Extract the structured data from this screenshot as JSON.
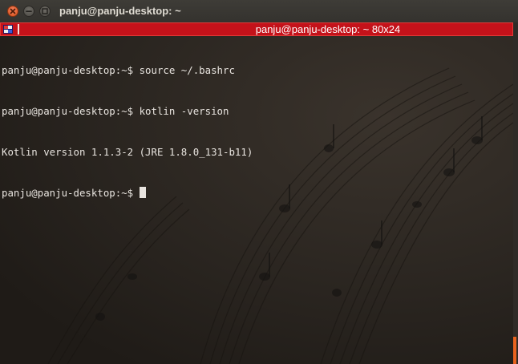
{
  "window": {
    "title": "panju@panju-desktop: ~",
    "buttons": [
      "close",
      "minimize",
      "maximize"
    ]
  },
  "statusbar": {
    "text": "panju@panju-desktop: ~ 80x24",
    "color": "#c4121a"
  },
  "terminal": {
    "lines": [
      "panju@panju-desktop:~$ source ~/.bashrc",
      "panju@panju-desktop:~$ kotlin -version",
      "Kotlin version 1.1.3-2 (JRE 1.8.0_131-b11)",
      "panju@panju-desktop:~$"
    ],
    "text_color": "#e8e4df",
    "background_color": "#2b2621"
  },
  "scrollbar": {
    "thumb_color": "#e9621e"
  }
}
